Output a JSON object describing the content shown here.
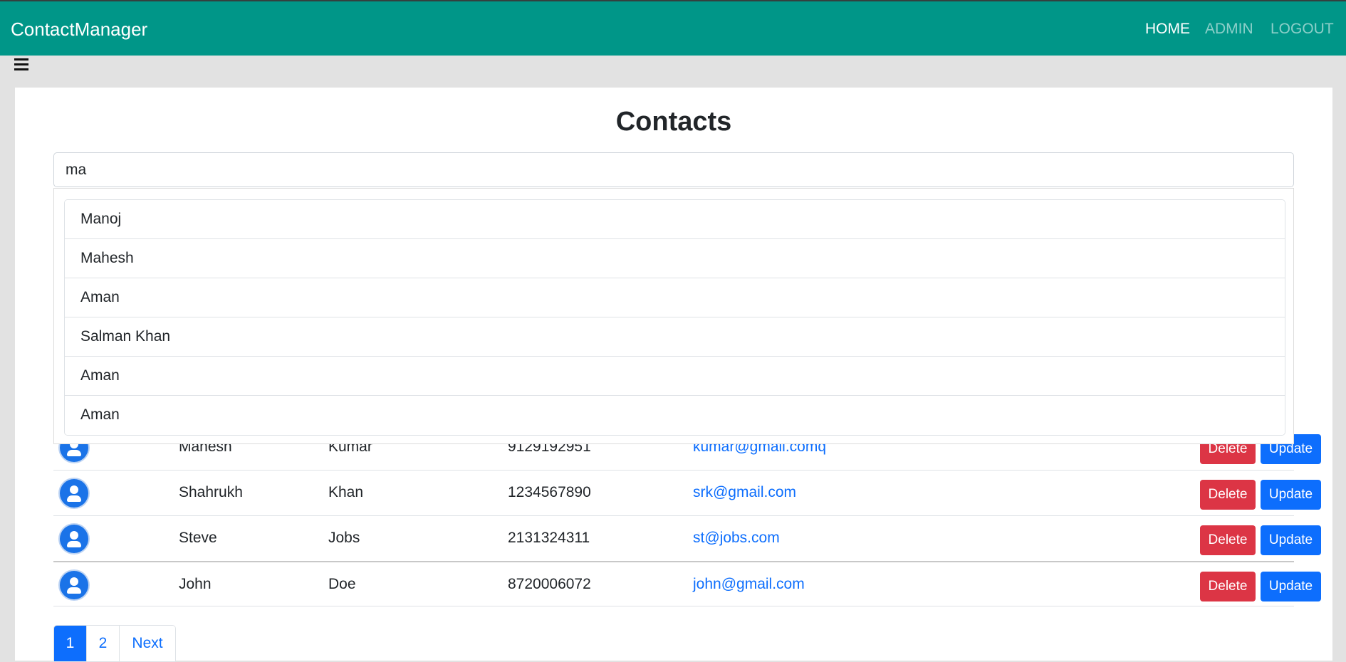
{
  "navbar": {
    "brand": "ContactManager",
    "links": [
      "HOME",
      "ADMIN",
      "LOGOUT"
    ],
    "color": "#009688"
  },
  "page": {
    "title": "Contacts"
  },
  "search": {
    "value": "ma"
  },
  "suggestions": [
    "Manoj",
    "Mahesh",
    "Aman",
    "Salman Khan",
    "Aman",
    "Aman"
  ],
  "contacts": [
    {
      "first": "Mahesh",
      "last": "Kumar",
      "phone": "9129192951",
      "email": "kumar@gmail.comq"
    },
    {
      "first": "Shahrukh",
      "last": "Khan",
      "phone": "1234567890",
      "email": "srk@gmail.com"
    },
    {
      "first": "Steve",
      "last": "Jobs",
      "phone": "2131324311",
      "email": "st@jobs.com"
    },
    {
      "first": "John",
      "last": "Doe",
      "phone": "8720006072",
      "email": "john@gmail.com"
    }
  ],
  "actions": {
    "delete_label": "Delete",
    "update_label": "Update"
  },
  "pagination": {
    "pages": [
      "1",
      "2"
    ],
    "next_label": "Next",
    "current": "1"
  },
  "colors": {
    "delete": "#dc3545",
    "primary": "#0d6efd"
  }
}
